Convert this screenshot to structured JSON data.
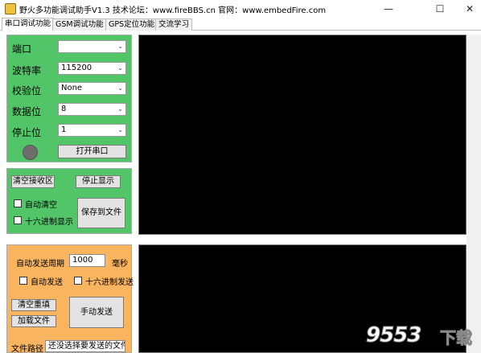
{
  "window": {
    "title": "野火多功能调试助手V1.3    技术论坛：www.fireBBS.cn    官网：www.embedFire.com",
    "minimize": "—",
    "maximize": "☐",
    "close": "✕"
  },
  "tabs": [
    {
      "label": "串口调试功能",
      "active": true
    },
    {
      "label": "GSM调试功能",
      "active": false
    },
    {
      "label": "GPS定位功能",
      "active": false
    },
    {
      "label": "交流学习",
      "active": false
    }
  ],
  "serial": {
    "port_label": "端口",
    "port_value": "",
    "baud_label": "波特率",
    "baud_value": "115200",
    "parity_label": "校验位",
    "parity_value": "None",
    "databits_label": "数据位",
    "databits_value": "8",
    "stopbits_label": "停止位",
    "stopbits_value": "1",
    "open_button": "打开串口",
    "led_color": "#6e6e6e"
  },
  "receive": {
    "clear_button": "清空接收区",
    "stop_button": "停止显示",
    "auto_clear_label": "自动清空",
    "hex_display_label": "十六进制显示",
    "save_button": "保存到文件"
  },
  "send": {
    "auto_period_label": "自动发送周期",
    "period_value": "1000",
    "unit_label": "毫秒",
    "auto_send_label": "自动发送",
    "hex_send_label": "十六进制发送",
    "clear_fill_button": "清空重填",
    "manual_send_button": "手动发送",
    "load_file_button": "加载文件",
    "file_path_label": "文件路径",
    "file_path_value": "还没选择要发送的文件"
  },
  "colors": {
    "serial_panel": "#52c569",
    "send_panel": "#f9b45f",
    "screen": "#000000"
  },
  "watermark": {
    "number": "9553",
    "text": "下载"
  }
}
